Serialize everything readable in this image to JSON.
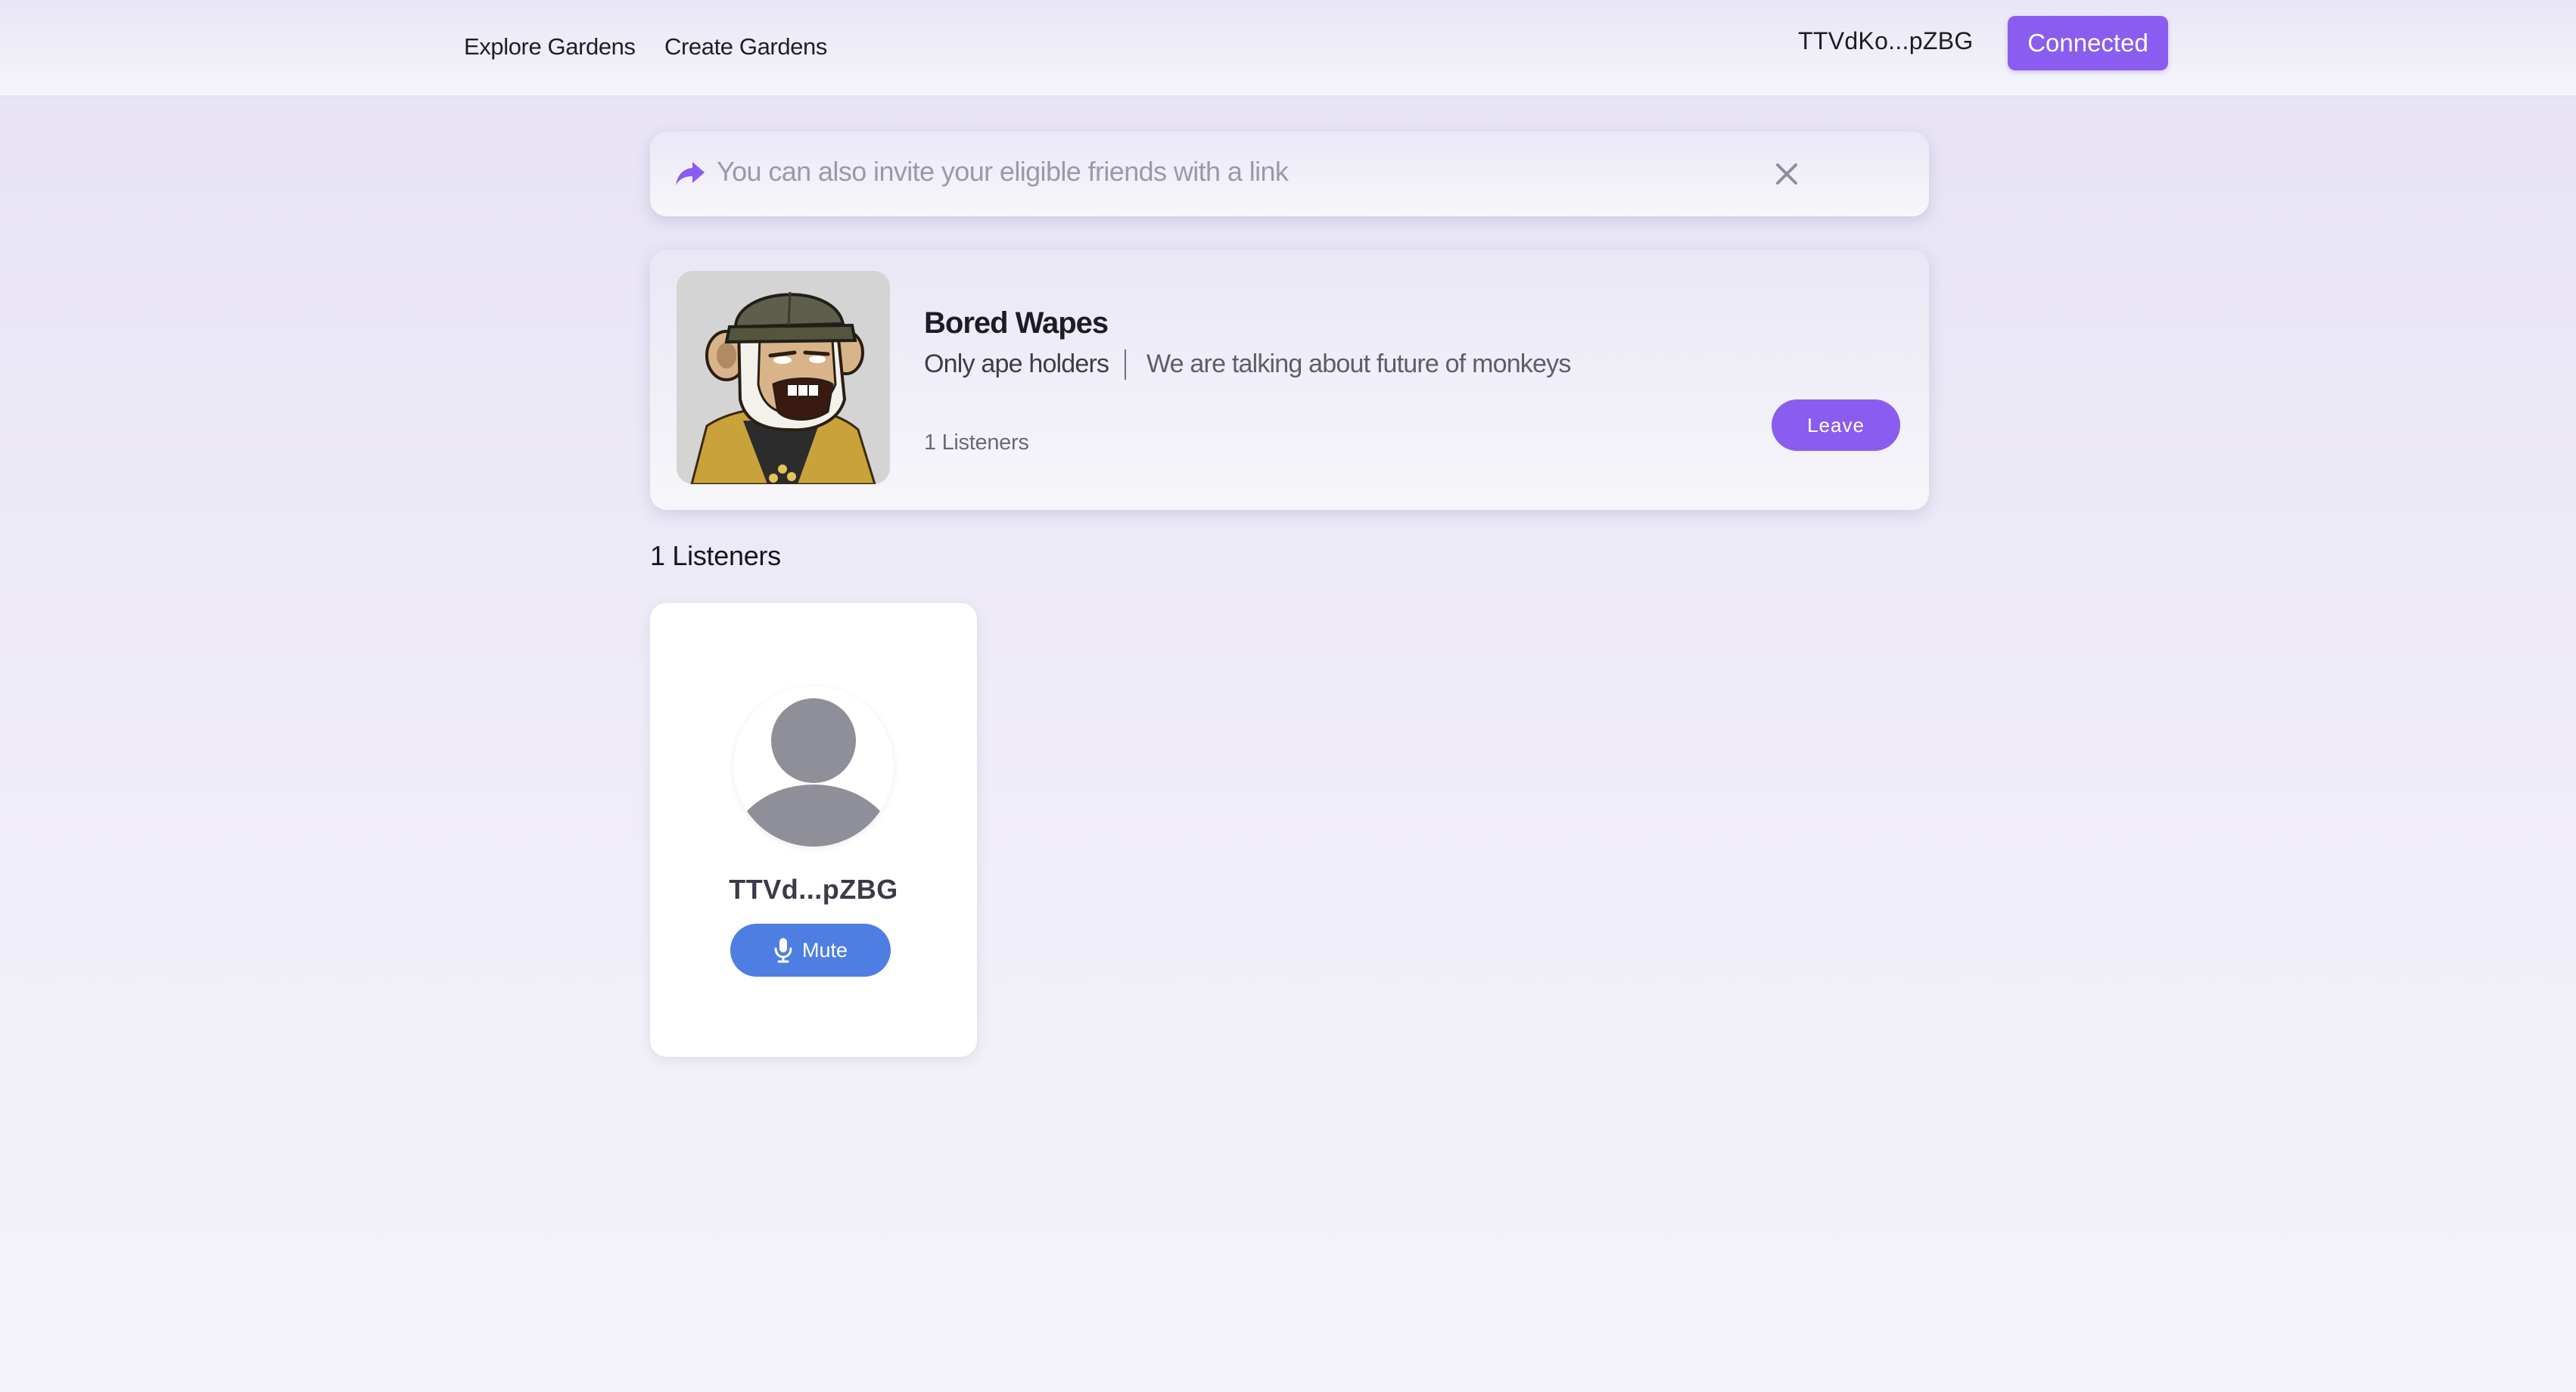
{
  "nav": {
    "explore_label": "Explore Gardens",
    "create_label": "Create Gardens",
    "wallet_address": "TTVdKo...pZBG",
    "connect_label": "Connected"
  },
  "invite_banner": {
    "text": "You can also invite your eligible friends with a link",
    "icon": "share-icon",
    "close_icon": "close-icon"
  },
  "room": {
    "title": "Bored Wapes",
    "audience": "Only ape holders",
    "topic": "We are talking about future of monkeys",
    "listeners_label": "1 Listeners",
    "leave_label": "Leave",
    "image": "ape-avatar"
  },
  "listeners_section": {
    "heading": "1 Listeners",
    "listeners": [
      {
        "name": "TTVd...pZBG",
        "mute_label": "Mute",
        "avatar": "default-user-avatar"
      }
    ]
  },
  "colors": {
    "accent_purple": "#8a5cf0",
    "mute_blue": "#4f7ee3",
    "page_bg": "#eeebf7"
  }
}
